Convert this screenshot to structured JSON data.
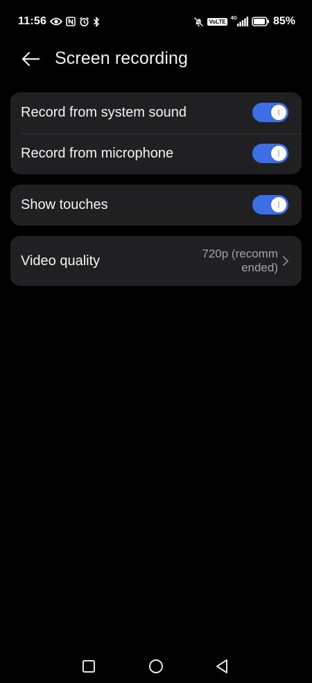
{
  "status_bar": {
    "time": "11:56",
    "volte": "VoLTE",
    "network": "4G",
    "battery_percent": "85%",
    "left_icons": [
      "eye-icon",
      "nfc-icon",
      "alarm-icon",
      "bluetooth-icon"
    ],
    "right_icons": [
      "notifications-off-icon",
      "volte-icon",
      "signal-icon",
      "battery-icon"
    ]
  },
  "header": {
    "title": "Screen recording",
    "back_icon": "arrow-left-icon"
  },
  "settings": {
    "system_sound": {
      "label": "Record from system sound",
      "enabled": true
    },
    "microphone": {
      "label": "Record from microphone",
      "enabled": true
    },
    "show_touches": {
      "label": "Show touches",
      "enabled": true
    },
    "video_quality": {
      "label": "Video quality",
      "value_line1": "720p (recomm",
      "value_line2": "ended)",
      "chevron_icon": "chevron-right-icon"
    }
  },
  "nav_bar": {
    "icons": [
      "recents-icon",
      "home-icon",
      "back-icon"
    ]
  },
  "colors": {
    "background": "#000000",
    "card": "#202022",
    "accent": "#3e6ee6",
    "secondary_text": "#a4a4a6"
  }
}
